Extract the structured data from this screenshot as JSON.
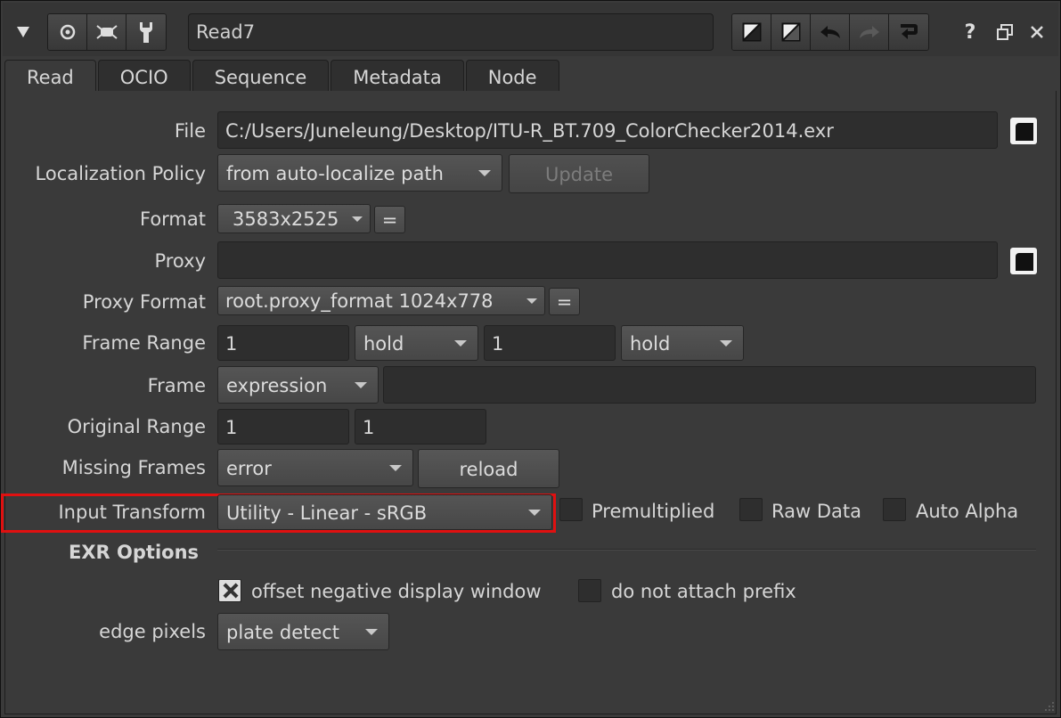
{
  "window": {
    "node_name": "Read7",
    "help_label": "?"
  },
  "tabs": [
    {
      "label": "Read"
    },
    {
      "label": "OCIO"
    },
    {
      "label": "Sequence"
    },
    {
      "label": "Metadata"
    },
    {
      "label": "Node"
    }
  ],
  "read": {
    "file": {
      "label": "File",
      "value": "C:/Users/Juneleung/Desktop/ITU-R_BT.709_ColorChecker2014.exr"
    },
    "localization": {
      "label": "Localization Policy",
      "value": "from auto-localize path",
      "update_label": "Update"
    },
    "format": {
      "label": "Format",
      "value": "3583x2525",
      "eq_label": "="
    },
    "proxy": {
      "label": "Proxy",
      "value": ""
    },
    "proxy_format": {
      "label": "Proxy Format",
      "value": "root.proxy_format 1024x778",
      "eq_label": "="
    },
    "frame_range": {
      "label": "Frame Range",
      "start": "1",
      "start_mode": "hold",
      "end": "1",
      "end_mode": "hold"
    },
    "frame": {
      "label": "Frame",
      "mode": "expression",
      "value": ""
    },
    "original_range": {
      "label": "Original Range",
      "start": "1",
      "end": "1"
    },
    "missing_frames": {
      "label": "Missing Frames",
      "value": "error",
      "reload_label": "reload"
    },
    "input_transform": {
      "label": "Input Transform",
      "value": "Utility - Linear - sRGB"
    },
    "premultiplied": {
      "label": "Premultiplied",
      "checked": false
    },
    "raw_data": {
      "label": "Raw Data",
      "checked": false
    },
    "auto_alpha": {
      "label": "Auto Alpha",
      "checked": false
    }
  },
  "exr_options": {
    "title": "EXR Options",
    "offset_negative": {
      "label": "offset negative display window",
      "checked": true
    },
    "no_prefix": {
      "label": "do not attach prefix",
      "checked": false
    },
    "edge_pixels": {
      "label": "edge pixels",
      "value": "plate detect"
    }
  },
  "colors": {
    "highlight": "#e01010",
    "panel": "#3a3a3a"
  }
}
